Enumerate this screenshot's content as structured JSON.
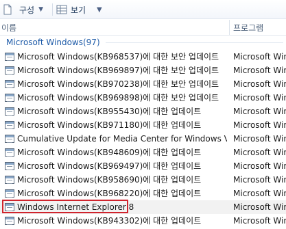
{
  "toolbar": {
    "organize_label": "구성",
    "view_label": "보기",
    "organize_icon": "document-icon",
    "view_icon": "grid-view-icon",
    "dropdown_icon": "chevron-down-icon"
  },
  "columns": {
    "name": "이름",
    "program": "프로그램"
  },
  "group": {
    "label": "Microsoft Windows(97)"
  },
  "rows": [
    {
      "name": "Microsoft Windows(KB968537)에 대한 보안 업데이트",
      "program": "Microsoft Windows"
    },
    {
      "name": "Microsoft Windows(KB969897)에 대한 보안 업데이트",
      "program": "Microsoft Windows"
    },
    {
      "name": "Microsoft Windows(KB970238)에 대한 보안 업데이트",
      "program": "Microsoft Windows"
    },
    {
      "name": "Microsoft Windows(KB969898)에 대한 보안 업데이트",
      "program": "Microsoft Windows"
    },
    {
      "name": "Microsoft Windows(KB955430)에 대한 업데이트",
      "program": "Microsoft Windows"
    },
    {
      "name": "Microsoft Windows(KB971180)에 대한 업데이트",
      "program": "Microsoft Windows"
    },
    {
      "name": "Cumulative Update for Media Center for Windows Vista",
      "program": "Microsoft Windows"
    },
    {
      "name": "Microsoft Windows(KB948609)에 대한 업데이트",
      "program": "Microsoft Windows"
    },
    {
      "name": "Microsoft Windows(KB969497)에 대한 업데이트",
      "program": "Microsoft Windows"
    },
    {
      "name": "Microsoft Windows(KB958690)에 대한 업데이트",
      "program": "Microsoft Windows"
    },
    {
      "name": "Microsoft Windows(KB968220)에 대한 업데이트",
      "program": "Microsoft Windows"
    },
    {
      "name": "Windows Internet Explorer 8",
      "program": "Microsoft Windows"
    },
    {
      "name": "Microsoft Windows(KB943302)에 대한 업데이트",
      "program": "Microsoft Windows"
    }
  ],
  "selected_row_index": 11,
  "colors": {
    "highlight_border": "#d0242d",
    "group_label": "#1e5ba8",
    "selected_row_bg": "#f2f2f2"
  }
}
